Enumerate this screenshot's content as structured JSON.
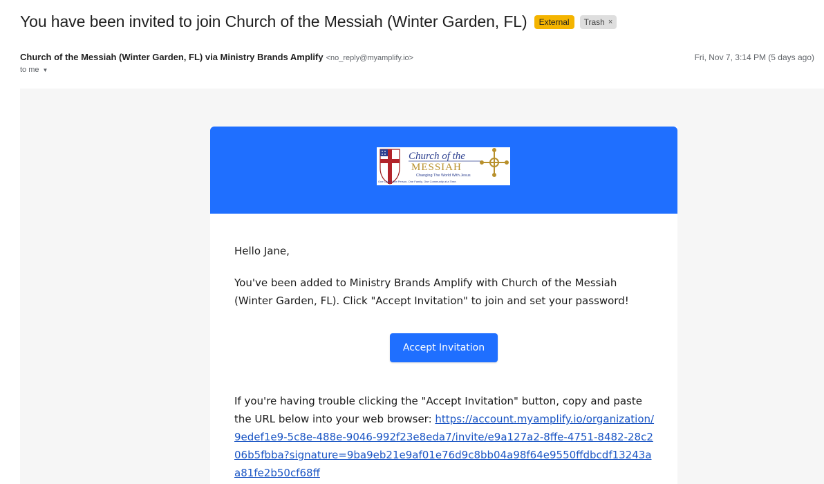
{
  "subject": {
    "title": "You have been invited to join Church of the Messiah (Winter Garden, FL)",
    "labels": {
      "external": "External",
      "trash": "Trash",
      "trash_close": "×"
    }
  },
  "sender": {
    "name": "Church of the Messiah (Winter Garden, FL) via Ministry Brands Amplify",
    "email": "<no_reply@myamplify.io>",
    "date": "Fri, Nov 7, 3:14 PM (5 days ago)",
    "to": "to me",
    "to_caret": "▼"
  },
  "email": {
    "banner_color": "#1f6fff",
    "logo": {
      "line1": "Church of the",
      "line2": "MESSIAH",
      "tagline": "Changing The World With Jesus",
      "subtagline": "One Child, One Person, One Family, One Community at a Time."
    },
    "greeting": "Hello Jane,",
    "body": "You've been added to Ministry Brands Amplify with Church of the Messiah (Winter Garden, FL). Click \"Accept Invitation\" to join and set your password!",
    "button_label": "Accept Invitation",
    "trouble_text": "If you're having trouble clicking the \"Accept Invitation\" button, copy and paste the URL below into your web browser: ",
    "url": "https://account.myamplify.io/organization/9edef1e9-5c8e-488e-9046-992f23e8eda7/invite/e9a127a2-8ffe-4751-8482-28c206b5fbba?signature=9ba9eb21e9af01e76d9c8bb04a98f64e9550ffdbcdf13243aa81fe2b50cf68ff"
  }
}
